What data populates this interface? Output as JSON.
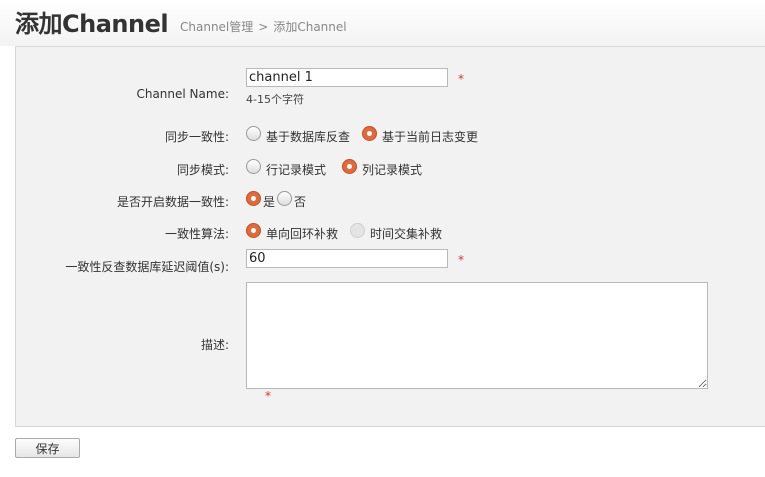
{
  "header": {
    "title": "添加Channel",
    "breadcrumb": [
      "Channel管理",
      ">",
      "添加Channel"
    ]
  },
  "form": {
    "channel_name": {
      "label": "Channel Name:",
      "value": "channel 1",
      "hint": "4-15个字符",
      "required": "*"
    },
    "sync_consistency": {
      "label": "同步一致性:",
      "options": [
        {
          "label": "基于数据库反查",
          "selected": false
        },
        {
          "label": "基于当前日志变更",
          "selected": true
        }
      ]
    },
    "sync_mode": {
      "label": "同步模式:",
      "options": [
        {
          "label": "行记录模式",
          "selected": false
        },
        {
          "label": "列记录模式",
          "selected": true
        }
      ]
    },
    "enable_consistency": {
      "label": "是否开启数据一致性:",
      "options": [
        {
          "label": "是",
          "selected": true
        },
        {
          "label": "否",
          "selected": false
        }
      ]
    },
    "consistency_algorithm": {
      "label": "一致性算法:",
      "options": [
        {
          "label": "单向回环补救",
          "selected": true
        },
        {
          "label": "时间交集补救",
          "selected": false,
          "disabled": true
        }
      ]
    },
    "reverse_delay": {
      "label": "一致性反查数据库延迟阈值(s):",
      "value": "60",
      "required": "*"
    },
    "description": {
      "label": "描述:",
      "value": "",
      "required": "*"
    }
  },
  "actions": {
    "save_label": "保存"
  },
  "colors": {
    "accent": "#e06a3a",
    "required": "#dd3333",
    "panel_bg": "#f2f2f2"
  }
}
